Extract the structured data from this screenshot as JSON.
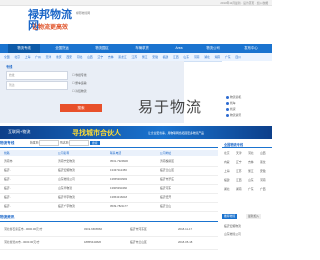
{
  "topbar": {
    "links": "2013年11月最新 · 设为首页 · 加入收藏"
  },
  "logo": {
    "main": "禄邦物流网",
    "sub": "让物流更高效"
  },
  "site_url": "禄邦物流网",
  "nav": [
    "物流专线",
    "全国货运",
    "物流园区",
    "车辆求货",
    "Area",
    "物流公司",
    "发布中心"
  ],
  "city_row": [
    "全国",
    "北京",
    "上海",
    "广州",
    "天津",
    "重庆",
    "西安",
    "河北",
    "山西",
    "辽宁",
    "吉林",
    "黑龙江",
    "江苏",
    "浙江",
    "安徽",
    "福建",
    "江西",
    "山东",
    "河南",
    "湖北",
    "湖南",
    "广东",
    "四川"
  ],
  "search": {
    "tab_label": "专线",
    "from_placeholder": "始发",
    "to_placeholder": "到达",
    "checks": [
      "零担专线",
      "整车运输",
      "冷链物流"
    ],
    "submit": "搜索"
  },
  "hero": {
    "text": "易于物流"
  },
  "right_panel": {
    "items": [
      "物流商机",
      "找车",
      "找货",
      "物流资讯"
    ]
  },
  "banner": {
    "left": "互联网+物流",
    "mid": "寻找城市合伙人",
    "right": "让企业更省事，用物联网络拓展更多物流产品"
  },
  "list_section": {
    "title": "物流专线",
    "filter_start": "始发地",
    "filter_end": "到达地",
    "search_btn": "搜索",
    "columns": [
      "线路",
      "公司名称",
      "联系电话",
      "公司地址"
    ],
    "rows": [
      {
        "line": "济南市-",
        "company": "济南宁宏物流",
        "phone": "0531-7929930",
        "addr": "济南槐荫区"
      },
      {
        "line": "临沂-",
        "company": "临沂宏顺物流",
        "phone": "13437112456",
        "addr": "临沂兰山区"
      },
      {
        "line": "临沂-",
        "company": "山东物流公司",
        "phone": "13655303993",
        "addr": "临沂市罗庄"
      },
      {
        "line": "临沂-",
        "company": "山东华物流",
        "phone": "13905393460",
        "addr": "临沂河东"
      },
      {
        "line": "临沂-",
        "company": "临沂华宇物流",
        "phone": "13954316018",
        "addr": "临沂经开"
      },
      {
        "line": "临沂-",
        "company": "临沂广宇物流",
        "phone": "0539-7821177",
        "addr": "临沂兰山"
      }
    ]
  },
  "news_section": {
    "title": "物流资讯",
    "rows": [
      {
        "text": "河北省石家庄市...0000.00元/方",
        "phone": "0319-6666566",
        "addr": "临沂市河东区",
        "date": "2018-11-17"
      },
      {
        "text": "河北省沧州市...0000.00元/方",
        "phone": "18855443826",
        "addr": "临沂市兰山区",
        "date": "2018-05-18"
      }
    ]
  },
  "sidebar": {
    "title": "全国物流专线",
    "cities": [
      "北京",
      "天津",
      "河北",
      "山西",
      "内蒙",
      "辽宁",
      "吉林",
      "黑龙",
      "上海",
      "江苏",
      "浙江",
      "安徽",
      "福建",
      "江西",
      "山东",
      "河南",
      "湖北",
      "湖南",
      "广东",
      "广西"
    ],
    "tabs": [
      "推荐物流",
      "最新加入"
    ],
    "tab_items": [
      "临沂宏顺物流",
      "山东物流公司"
    ]
  }
}
